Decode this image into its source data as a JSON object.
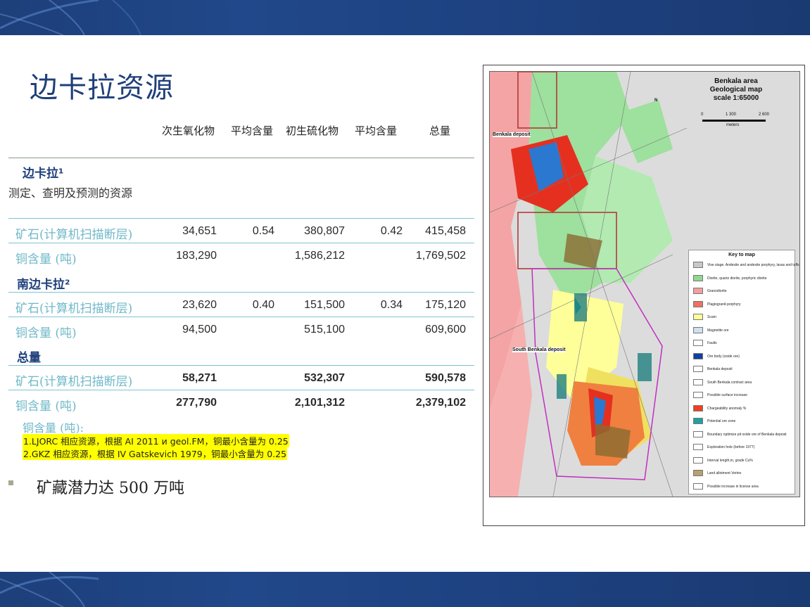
{
  "title": "边卡拉资源",
  "headers": [
    "次生氧化物",
    "平均含量",
    "初生硫化物",
    "平均含量",
    "总量"
  ],
  "sections": [
    {
      "name": "边卡拉¹",
      "subtitle": "测定、查明及预测的资源",
      "rows": [
        {
          "label": "矿石(计算机扫描断层)",
          "values": [
            "34,651",
            "0.54",
            "380,807",
            "0.42",
            "415,458"
          ]
        },
        {
          "label": "铜含量 (吨)",
          "values": [
            "183,290",
            "",
            "1,586,212",
            "",
            "1,769,502"
          ]
        }
      ]
    },
    {
      "name": "南边卡拉²",
      "subtitle": "",
      "rows": [
        {
          "label": "矿石(计算机扫描断层)",
          "values": [
            "23,620",
            "0.40",
            "151,500",
            "0.34",
            "175,120"
          ]
        },
        {
          "label": "铜含量 (吨)",
          "values": [
            "94,500",
            "",
            "515,100",
            "",
            "609,600"
          ]
        }
      ]
    },
    {
      "name": "总量",
      "subtitle": "",
      "rows": [
        {
          "label": "矿石(计算机扫描断层)",
          "values": [
            "58,271",
            "",
            "532,307",
            "",
            "590,578"
          ]
        },
        {
          "label": "铜含量 (吨)",
          "values": [
            "277,790",
            "",
            "2,101,312",
            "",
            "2,379,102"
          ]
        }
      ]
    }
  ],
  "note": "铜含量 (吨):",
  "footnotes": [
    "1.LJORC 相应资源，根据 AI 2011 и geol.FM，铜最小含量为 0.25",
    "2.GKZ 相应资源，根据 IV Gatskevich 1979，铜最小含量为 0.25"
  ],
  "bullet": "矿藏潜力达 500 万吨",
  "map": {
    "title_lines": [
      "Benkala area",
      "Geological map",
      "scale 1:65000"
    ],
    "scale_ticks": [
      "0",
      "1 300",
      "2 600"
    ],
    "scale_unit": "meters",
    "north": "N",
    "label_benkala": "Benkala deposit",
    "label_south": "South Benkala deposit",
    "key_title": "Key to map",
    "key_items": [
      {
        "text": "Vise stage. Andesite and andesite porphyry, lavas and tuffs",
        "color": "#c8c8c8"
      },
      {
        "text": "Diorite, quartz diorite, porphyric diorite",
        "color": "#8fd88f"
      },
      {
        "text": "Granodiorite",
        "color": "#f0a0a0"
      },
      {
        "text": "Plagiogranit-porphyry",
        "color": "#f07060"
      },
      {
        "text": "Scarn",
        "color": "#ffff99"
      },
      {
        "text": "Magnetite ore",
        "color": "#cfe0f0"
      },
      {
        "text": "Faults",
        "color": "#ffffff"
      },
      {
        "text": "Ore body (oxide ore)",
        "color": "#1040a0"
      },
      {
        "text": "Benkala deposit",
        "color": "#ffffff"
      },
      {
        "text": "South Benkala contract area",
        "color": "#ffffff"
      },
      {
        "text": "Possible surface increase",
        "color": "#ffffff"
      },
      {
        "text": "Chargeability anomaly %",
        "color": "#f04020"
      },
      {
        "text": "Potential ore zone",
        "color": "#20a0a0"
      },
      {
        "text": "Boundary optimize pit oxide ore of Benkala deposit",
        "color": "#ffffff"
      },
      {
        "text": "Exploration hole (before 1977)",
        "color": "#ffffff"
      },
      {
        "text": "Interval length,m, grade Cu%",
        "color": "#ffffff"
      },
      {
        "text": "Land allotment Vertex",
        "color": "#b8a070"
      },
      {
        "text": "Possible increase in license area",
        "color": "#ffffff"
      }
    ]
  }
}
